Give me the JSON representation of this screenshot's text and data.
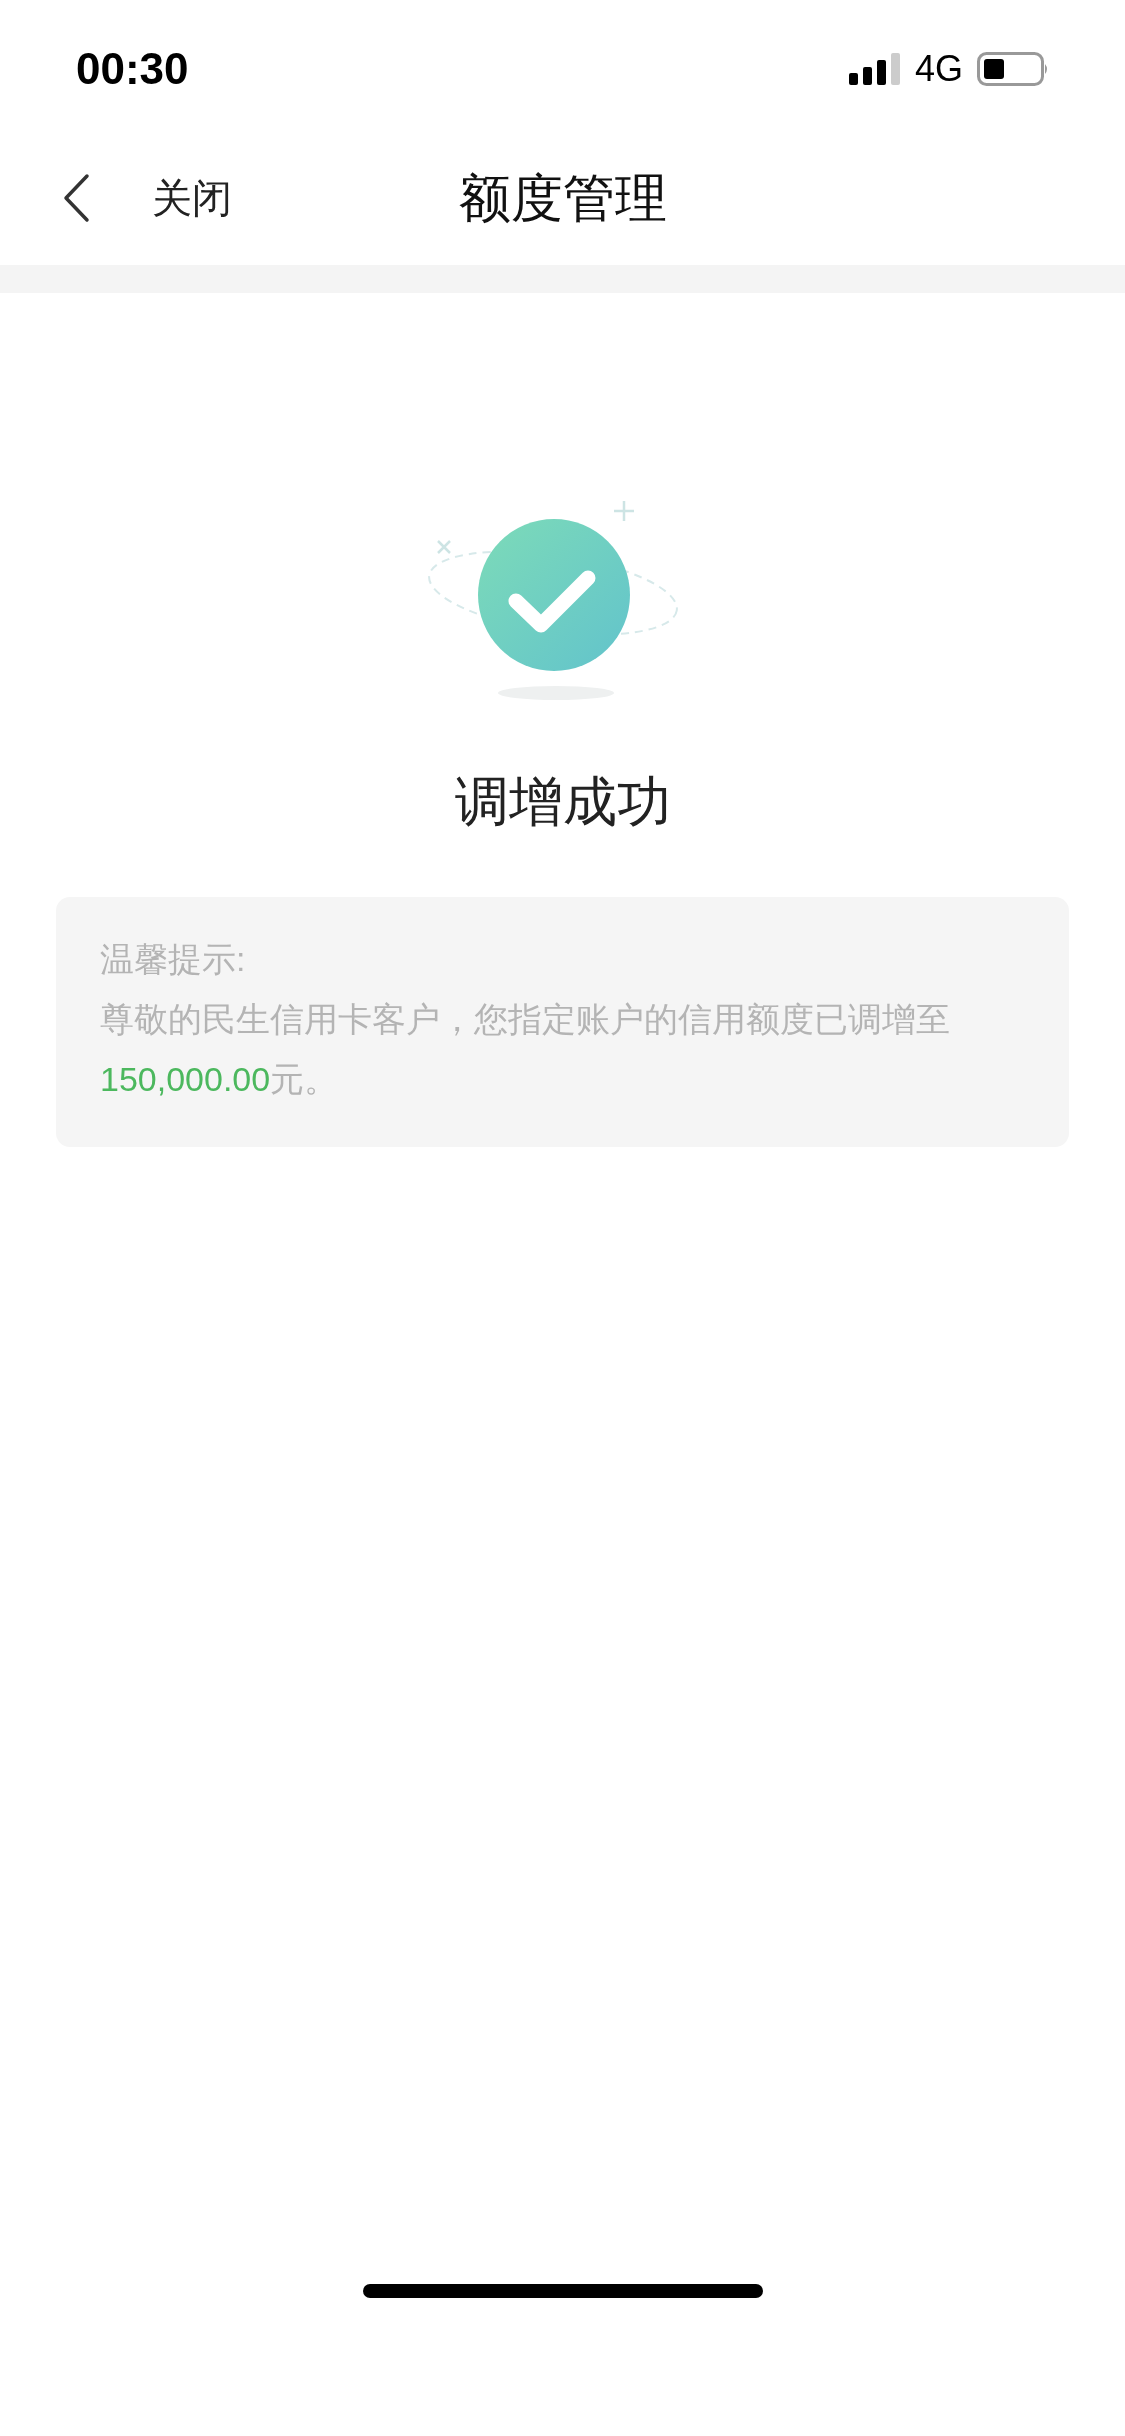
{
  "status_bar": {
    "time": "00:30",
    "network": "4G"
  },
  "nav_bar": {
    "back_label": "关闭",
    "title": "额度管理"
  },
  "result": {
    "title": "调增成功"
  },
  "notice": {
    "heading": "温馨提示:",
    "message": "尊敬的民生信用卡客户，您指定账户的信用额度已调增至",
    "amount": "150,000.00",
    "suffix": "元。"
  }
}
